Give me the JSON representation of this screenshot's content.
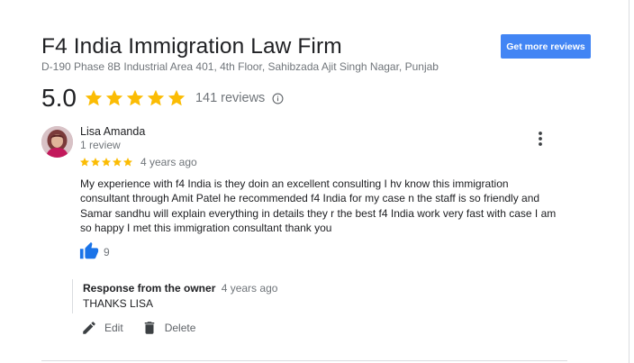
{
  "business": {
    "name": "F4 India Immigration Law Firm",
    "address": "D-190 Phase 8B Industrial Area 401, 4th Floor, Sahibzada Ajit Singh Nagar, Punjab"
  },
  "header": {
    "get_more_reviews_label": "Get more reviews"
  },
  "rating": {
    "value": "5.0",
    "stars": 5,
    "reviews_count": "141 reviews",
    "info_icon": "info-icon"
  },
  "review": {
    "reviewer_name": "Lisa Amanda",
    "reviewer_meta": "1 review",
    "stars": 5,
    "time": "4 years ago",
    "text": "My experience with f4 India is they doin an excellent consulting  I hv know this immigration consultant through Amit Patel he recommended f4 India for my case n the staff is so friendly and Samar sandhu will explain everything in details they r the best f4 India work very fast with case I am so happy I met this immigration consultant thank you",
    "likes": "9",
    "more_icon": "more-vert-icon",
    "like_icon": "thumbs-up-icon"
  },
  "response": {
    "label": "Response from the owner",
    "time": "4 years ago",
    "text": "THANKS LISA"
  },
  "actions": {
    "edit_label": "Edit",
    "delete_label": "Delete",
    "edit_icon": "pencil-icon",
    "delete_icon": "trash-icon"
  },
  "colors": {
    "star": "#fbbc04",
    "button": "#4285f4",
    "like": "#1a73e8",
    "secondary_text": "#70757a"
  }
}
